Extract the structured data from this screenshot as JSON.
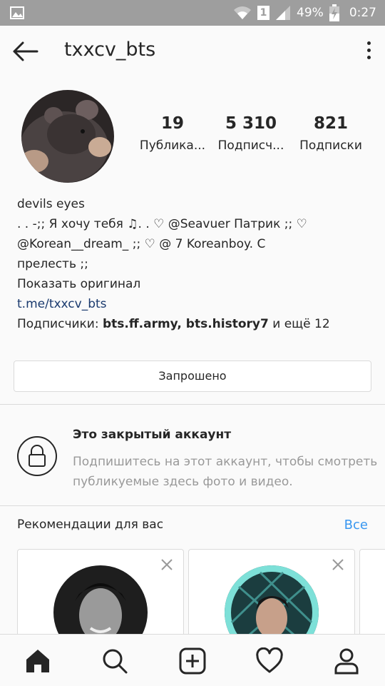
{
  "status_bar": {
    "battery": "49%",
    "time": "0:27",
    "sim": "1"
  },
  "header": {
    "username": "txxcv_bts"
  },
  "stats": [
    {
      "value": "19",
      "label": "Публика..."
    },
    {
      "value": "5 310",
      "label": "Подписч..."
    },
    {
      "value": "821",
      "label": "Подписки"
    }
  ],
  "bio": {
    "name": "devils eyes",
    "line1": ". . -;; Я хочу тебя ♫. . ♡ @Seavuer Патрик ;; ♡",
    "line2": "@Korean__dream_ ;; ♡ @ 7 Koreanboy. С",
    "line3": "прелесть ;;",
    "show_original": "Показать оригинал",
    "link": "t.me/txxcv_bts",
    "followers_prefix": "Подписчики: ",
    "followers_names": "bts.ff.army, bts.history7",
    "followers_suffix": " и ещё 12"
  },
  "requested_button": "Запрошено",
  "private": {
    "title": "Это закрытый аккаунт",
    "description": "Подпишитесь на этот аккаунт, чтобы смотреть публикуемые здесь фото и видео."
  },
  "recommendations": {
    "title": "Рекомендации для вас",
    "see_all": "Все"
  },
  "nav": [
    "home-icon",
    "search-icon",
    "add-post-icon",
    "heart-icon",
    "profile-icon"
  ]
}
